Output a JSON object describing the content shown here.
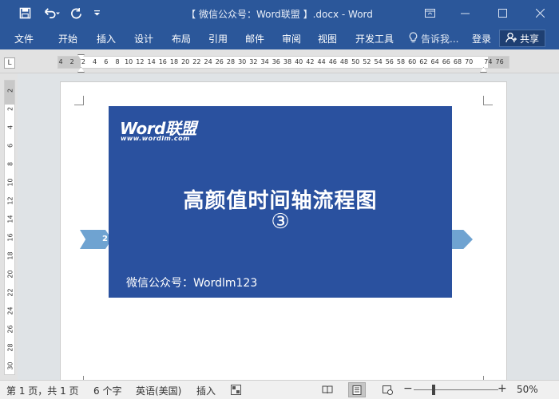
{
  "titlebar": {
    "title": "【 微信公众号：Word联盟 】.docx  -  Word",
    "save_icon": "save-icon",
    "undo_icon": "undo-icon",
    "redo_icon": "redo-icon",
    "customize_icon": "customize-qat-icon",
    "ribbon_options_icon": "ribbon-display-icon",
    "minimize_icon": "minimize-icon",
    "maximize_icon": "maximize-icon",
    "close_icon": "close-icon"
  },
  "ribbon": {
    "tabs": [
      "文件",
      "开始",
      "插入",
      "设计",
      "布局",
      "引用",
      "邮件",
      "审阅",
      "视图",
      "开发工具"
    ],
    "tell_me": "告诉我...",
    "signin": "登录",
    "share": "共享"
  },
  "ruler": {
    "corner": "L",
    "h_ticks": [
      "4",
      "2",
      "2",
      "4",
      "6",
      "8",
      "10",
      "12",
      "14",
      "16",
      "18",
      "20",
      "22",
      "24",
      "26",
      "28",
      "30",
      "32",
      "34",
      "36",
      "38",
      "40",
      "42",
      "44",
      "46",
      "48",
      "50",
      "52",
      "54",
      "56",
      "58",
      "60",
      "62",
      "64",
      "66",
      "68",
      "70",
      "74",
      "76"
    ],
    "v_ticks": [
      "2",
      "2",
      "4",
      "6",
      "8",
      "10",
      "12",
      "14",
      "16",
      "18",
      "20",
      "22",
      "24",
      "26",
      "28",
      "30"
    ]
  },
  "document": {
    "arrow_left_label": "2",
    "banner": {
      "logo": "Word联盟",
      "logo_url": "www.wordlm.com",
      "title": "高颜值时间轴流程图",
      "number": "③",
      "footer": "微信公众号：Wordlm123",
      "color": "#2a519f"
    }
  },
  "statusbar": {
    "page": "第 1 页，共 1 页",
    "words": "6 个字",
    "language": "英语(美国)",
    "mode": "插入",
    "zoom_minus": "−",
    "zoom_plus": "+",
    "zoom": "50%"
  },
  "colors": {
    "accent": "#2b579a",
    "arrow": "#6fa3d1"
  }
}
